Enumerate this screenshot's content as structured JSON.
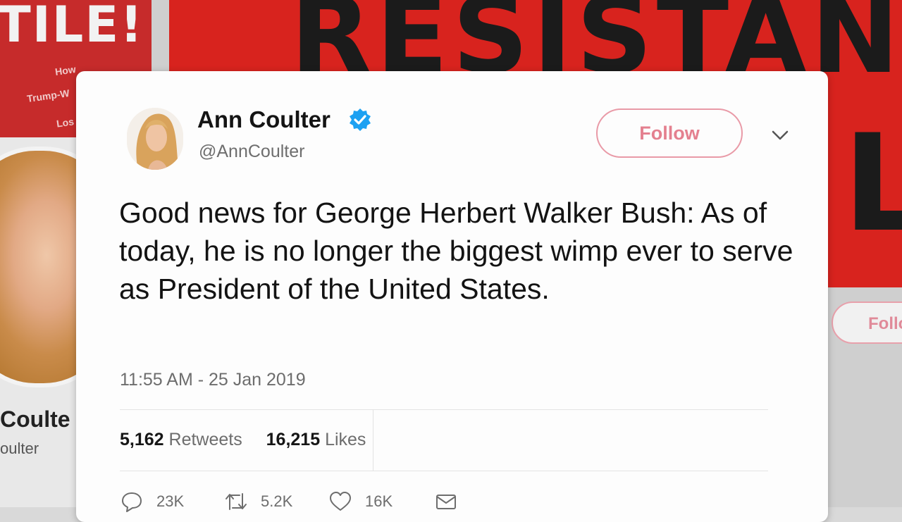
{
  "background": {
    "book_left_title": "TILE!",
    "book_left_lines": [
      "How",
      "Trump-W",
      "Los"
    ],
    "book_main_title": "RESISTANC",
    "book_main_letters": "LE",
    "profile_name": "Coulte",
    "profile_handle": "oulter",
    "follow_partial": "Follo"
  },
  "tweet": {
    "author_name": "Ann Coulter",
    "author_handle": "@AnnCoulter",
    "verified": true,
    "follow_label": "Follow",
    "text": "Good news for George Herbert Walker Bush: As of today, he is no longer the biggest wimp ever to serve as President of the United States.",
    "timestamp": "11:55 AM - 25 Jan 2019",
    "retweets_count": "5,162",
    "retweets_label": "Retweets",
    "likes_count": "16,215",
    "likes_label": "Likes",
    "actions": {
      "reply_count": "23K",
      "retweet_count": "5.2K",
      "like_count": "16K"
    }
  },
  "colors": {
    "follow_accent": "#e4808f",
    "verified_blue": "#1da1f2",
    "background_red": "#d8231e"
  },
  "icons": [
    "verified-badge-icon",
    "chevron-down-icon",
    "reply-icon",
    "retweet-icon",
    "like-icon",
    "message-icon"
  ]
}
